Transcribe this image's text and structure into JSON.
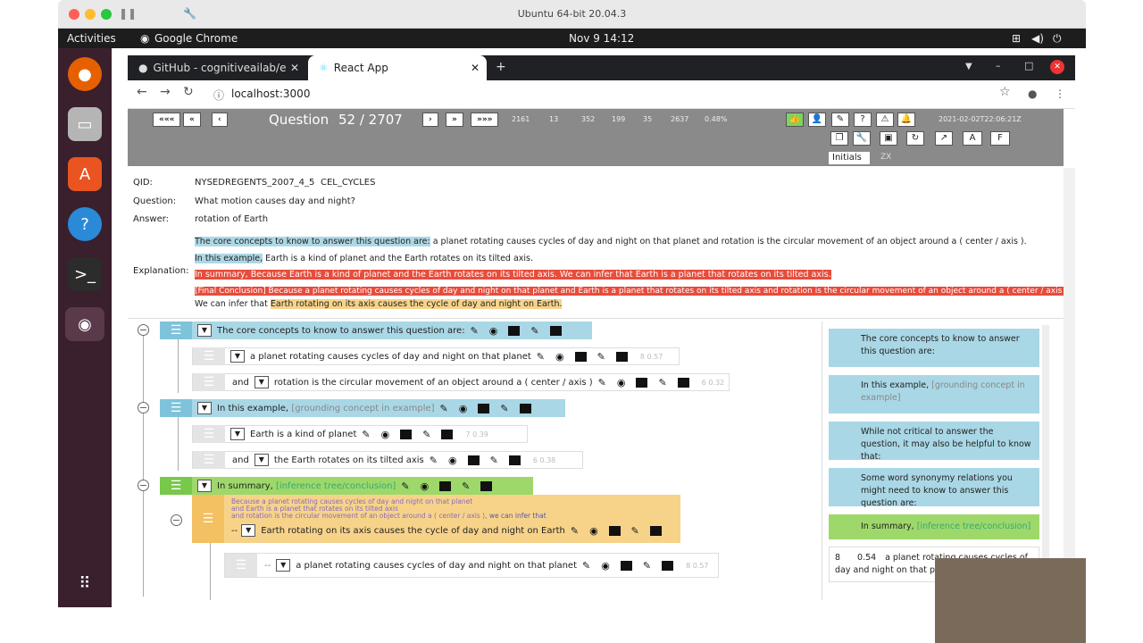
{
  "mac": {
    "title": "Ubuntu 64-bit 20.04.3"
  },
  "ubuntu": {
    "activities": "Activities",
    "app": "Google Chrome",
    "clock": "Nov 9  14:12"
  },
  "chrome": {
    "tabs": [
      {
        "label": "GitHub - cognitiveailab/e"
      },
      {
        "label": "React App"
      }
    ],
    "url": "localhost:3000"
  },
  "toolbar": {
    "nav": [
      "«««",
      "«",
      "‹",
      "›",
      "»",
      "»»»"
    ],
    "question_label": "Question",
    "counter": "52 / 2707",
    "stats": [
      "2161",
      "13",
      "352",
      "199",
      "35",
      "2637",
      "0.48%"
    ],
    "timestamp": "2021-02-02T22:06:21Z",
    "initials_label": "Initials",
    "initials_value": "ZX"
  },
  "info": {
    "qid_label": "QID:",
    "qid": "NYSEDREGENTS_2007_4_5",
    "topic": "CEL_CYCLES",
    "question_label": "Question:",
    "question": "What motion causes day and night?",
    "answer_label": "Answer:",
    "answer": "rotation of Earth",
    "explanation_label": "Explanation:"
  },
  "explanation": {
    "l1a": "The core concepts to know to answer this question are:",
    "l1b": " a planet rotating causes cycles of day and night on that planet and rotation is the circular movement of an object around a ( center / axis ).",
    "l2a": "In this example,",
    "l2b": " Earth is a kind of planet and the Earth rotates on its tilted axis.",
    "l3": "In summary, Because Earth is a kind of planet and the Earth rotates on its tilted axis. We can infer that Earth is a planet that rotates on its tilted axis.",
    "l4": "[Final Conclusion] Because a planet rotating causes cycles of day and night on that planet and Earth is a planet that rotates on its tilted axis and rotation is the circular movement of an object around a ( center / axis ).",
    "l5a": "We can infer that ",
    "l5b": "Earth rotating on its axis causes the cycle of day and night on Earth."
  },
  "tree": {
    "r1": "The core concepts to know to answer this question are:",
    "r2": "a planet rotating causes cycles of day and night on that planet",
    "r2s": "8  0.57",
    "r3and": "and",
    "r3": "rotation is the circular movement of an object around a ( center / axis )",
    "r3s": "6  0.32",
    "r4a": "In this example,",
    "r4b": "[grounding concept in example]",
    "r5": "Earth is a kind of planet",
    "r5s": "7  0.39",
    "r6and": "and",
    "r6": "the Earth rotates on its tilted axis",
    "r6s": "6  0.38",
    "r7a": "In summary,",
    "r7b": "[inference tree/conclusion]",
    "o1": "Because a planet rotating causes cycles of day and night on that planet",
    "o2": "and Earth is a planet that rotates on its tilted axis",
    "o3": "and rotation is the circular movement of an object around a ( center / axis )",
    "o3b": ", we can infer that",
    "o4": "Earth rotating on its axis causes the cycle of day and night on Earth",
    "r8": "a planet rotating causes cycles of day and night on that planet",
    "r8s": "8  0.57"
  },
  "side": {
    "c1": "The core concepts to know to answer this question are:",
    "c2a": "In this example,",
    "c2b": "[grounding concept in example]",
    "c3": "While not critical to answer the question, it may also be helpful to know that:",
    "c4": "Some word synonymy relations you might need to know to answer this question are:",
    "c5a": "In summary,",
    "c5b": "[inference tree/conclusion]",
    "c6n": "8",
    "c6s": "0.54",
    "c6t": "a planet rotating causes cycles of day and night on that planet"
  }
}
